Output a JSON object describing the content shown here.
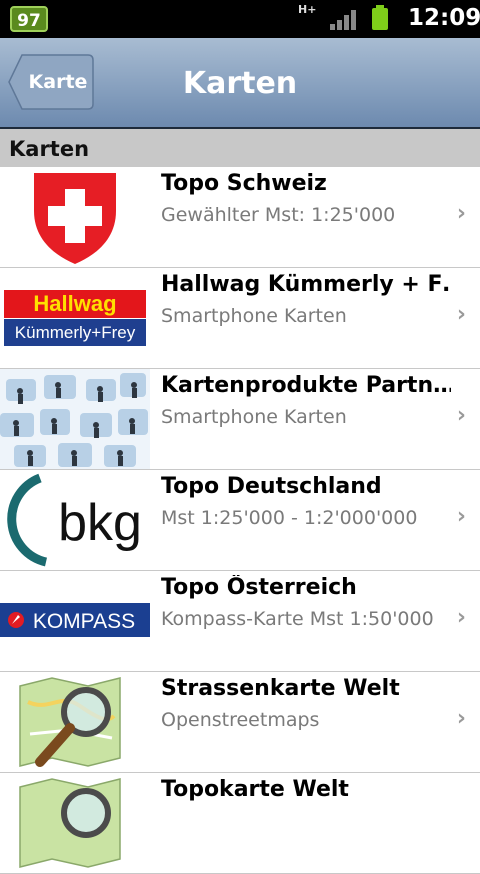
{
  "status": {
    "battery_percent": "97",
    "network": "H+",
    "time": "12:09"
  },
  "nav": {
    "back_label": "Karte",
    "title": "Karten"
  },
  "section": {
    "label": "Karten"
  },
  "items": [
    {
      "title": "Topo Schweiz",
      "subtitle": "Gewählter Mst: 1:25'000",
      "logo": "swiss-shield"
    },
    {
      "title": "Hallwag Kümmerly + F…",
      "subtitle": "Smartphone Karten",
      "logo": "hallwag-logo",
      "logo_top": "Hallwag",
      "logo_bottom": "Kümmerly+Frey"
    },
    {
      "title": "Kartenprodukte Partn…",
      "subtitle": "Smartphone Karten",
      "logo": "partner-network"
    },
    {
      "title": "Topo Deutschland",
      "subtitle": "Mst 1:25'000 - 1:2'000'000",
      "logo": "bkg-logo",
      "logo_text": "bkg"
    },
    {
      "title": "Topo Österreich",
      "subtitle": "Kompass-Karte Mst 1:50'000",
      "logo": "kompass-logo",
      "logo_text": "KOMPASS"
    },
    {
      "title": "Strassenkarte Welt",
      "subtitle": "Openstreetmaps",
      "logo": "osm-magnifier"
    },
    {
      "title": "Topokarte Welt",
      "subtitle": "",
      "logo": "osm-magnifier"
    }
  ]
}
